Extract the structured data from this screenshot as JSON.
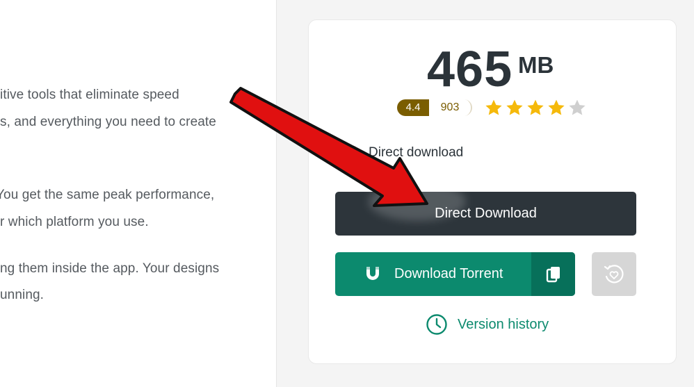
{
  "article": {
    "lines": [
      "itive tools that eliminate speed",
      "s, and everything you need to create",
      "You get the same peak performance,",
      "r which platform you use.",
      "ng them inside the app. Your designs",
      "unning."
    ]
  },
  "download": {
    "size_value": "465",
    "size_unit": "MB",
    "rating_score": "4.4",
    "rating_count": "903",
    "stars_filled": 4,
    "stars_total": 5,
    "option_label": "Direct download",
    "direct_button_label": "Direct Download",
    "torrent_button_label": "Download Torrent",
    "version_history_label": "Version history"
  },
  "colors": {
    "primary_dark": "#2d353b",
    "torrent_green": "#0c8a6e",
    "rating_brown": "#7a5d00",
    "star_gold": "#f5b90b",
    "annotation_arrow": "#e01010"
  },
  "icons": {
    "torrent": "magnet-icon",
    "copy": "copy-icon",
    "favorite": "heart-refresh-icon",
    "version": "clock-icon",
    "annotation": "red-arrow-icon"
  }
}
